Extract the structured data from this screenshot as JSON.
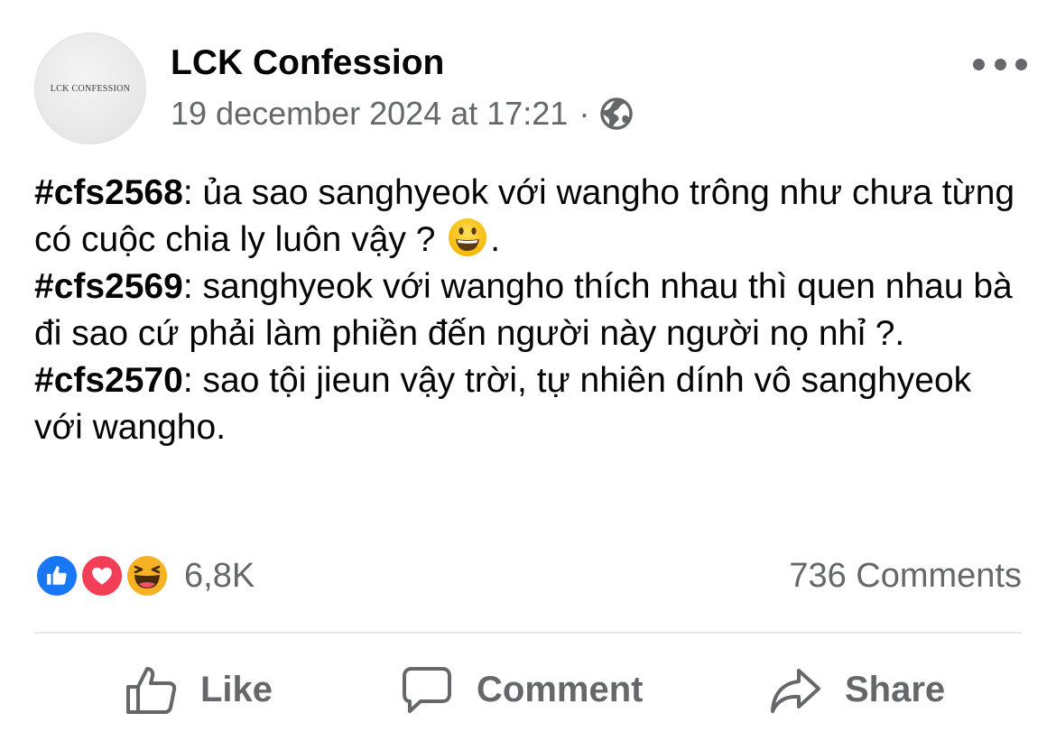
{
  "post": {
    "author": "LCK Confession",
    "avatar_text": "LCK CONFESSION",
    "timestamp": "19 december 2024 at 17:21",
    "separator": "·",
    "audience_icon": "globe-icon",
    "more_icon": "more-horizontal-icon",
    "confessions": [
      {
        "tag": "#cfs2568",
        "text_before": ": ủa sao sanghyeok với wangho trông như chưa từng có cuộc chia ly luôn vậy ? ",
        "emoji": "grinning-face-emoji",
        "text_after": "."
      },
      {
        "tag": "#cfs2569",
        "text": ": sanghyeok với wangho thích nhau thì quen nhau bà đi sao cứ phải làm phiền đến người này người nọ nhỉ ?."
      },
      {
        "tag": "#cfs2570",
        "text": ": sao tội jieun vậy trời, tự nhiên dính vô sanghyeok với wangho."
      }
    ]
  },
  "engagement": {
    "reaction_icons": [
      "like-reaction-icon",
      "love-reaction-icon",
      "haha-reaction-icon"
    ],
    "reaction_count": "6,8K",
    "comments_count": "736 Comments"
  },
  "actions": {
    "like_label": "Like",
    "comment_label": "Comment",
    "share_label": "Share"
  },
  "colors": {
    "text_primary": "#050505",
    "text_secondary": "#65676b",
    "like_blue": "#1877f2",
    "love_red": "#f33e58",
    "haha_yellow": "#f7b125",
    "divider": "#e4e6eb"
  }
}
